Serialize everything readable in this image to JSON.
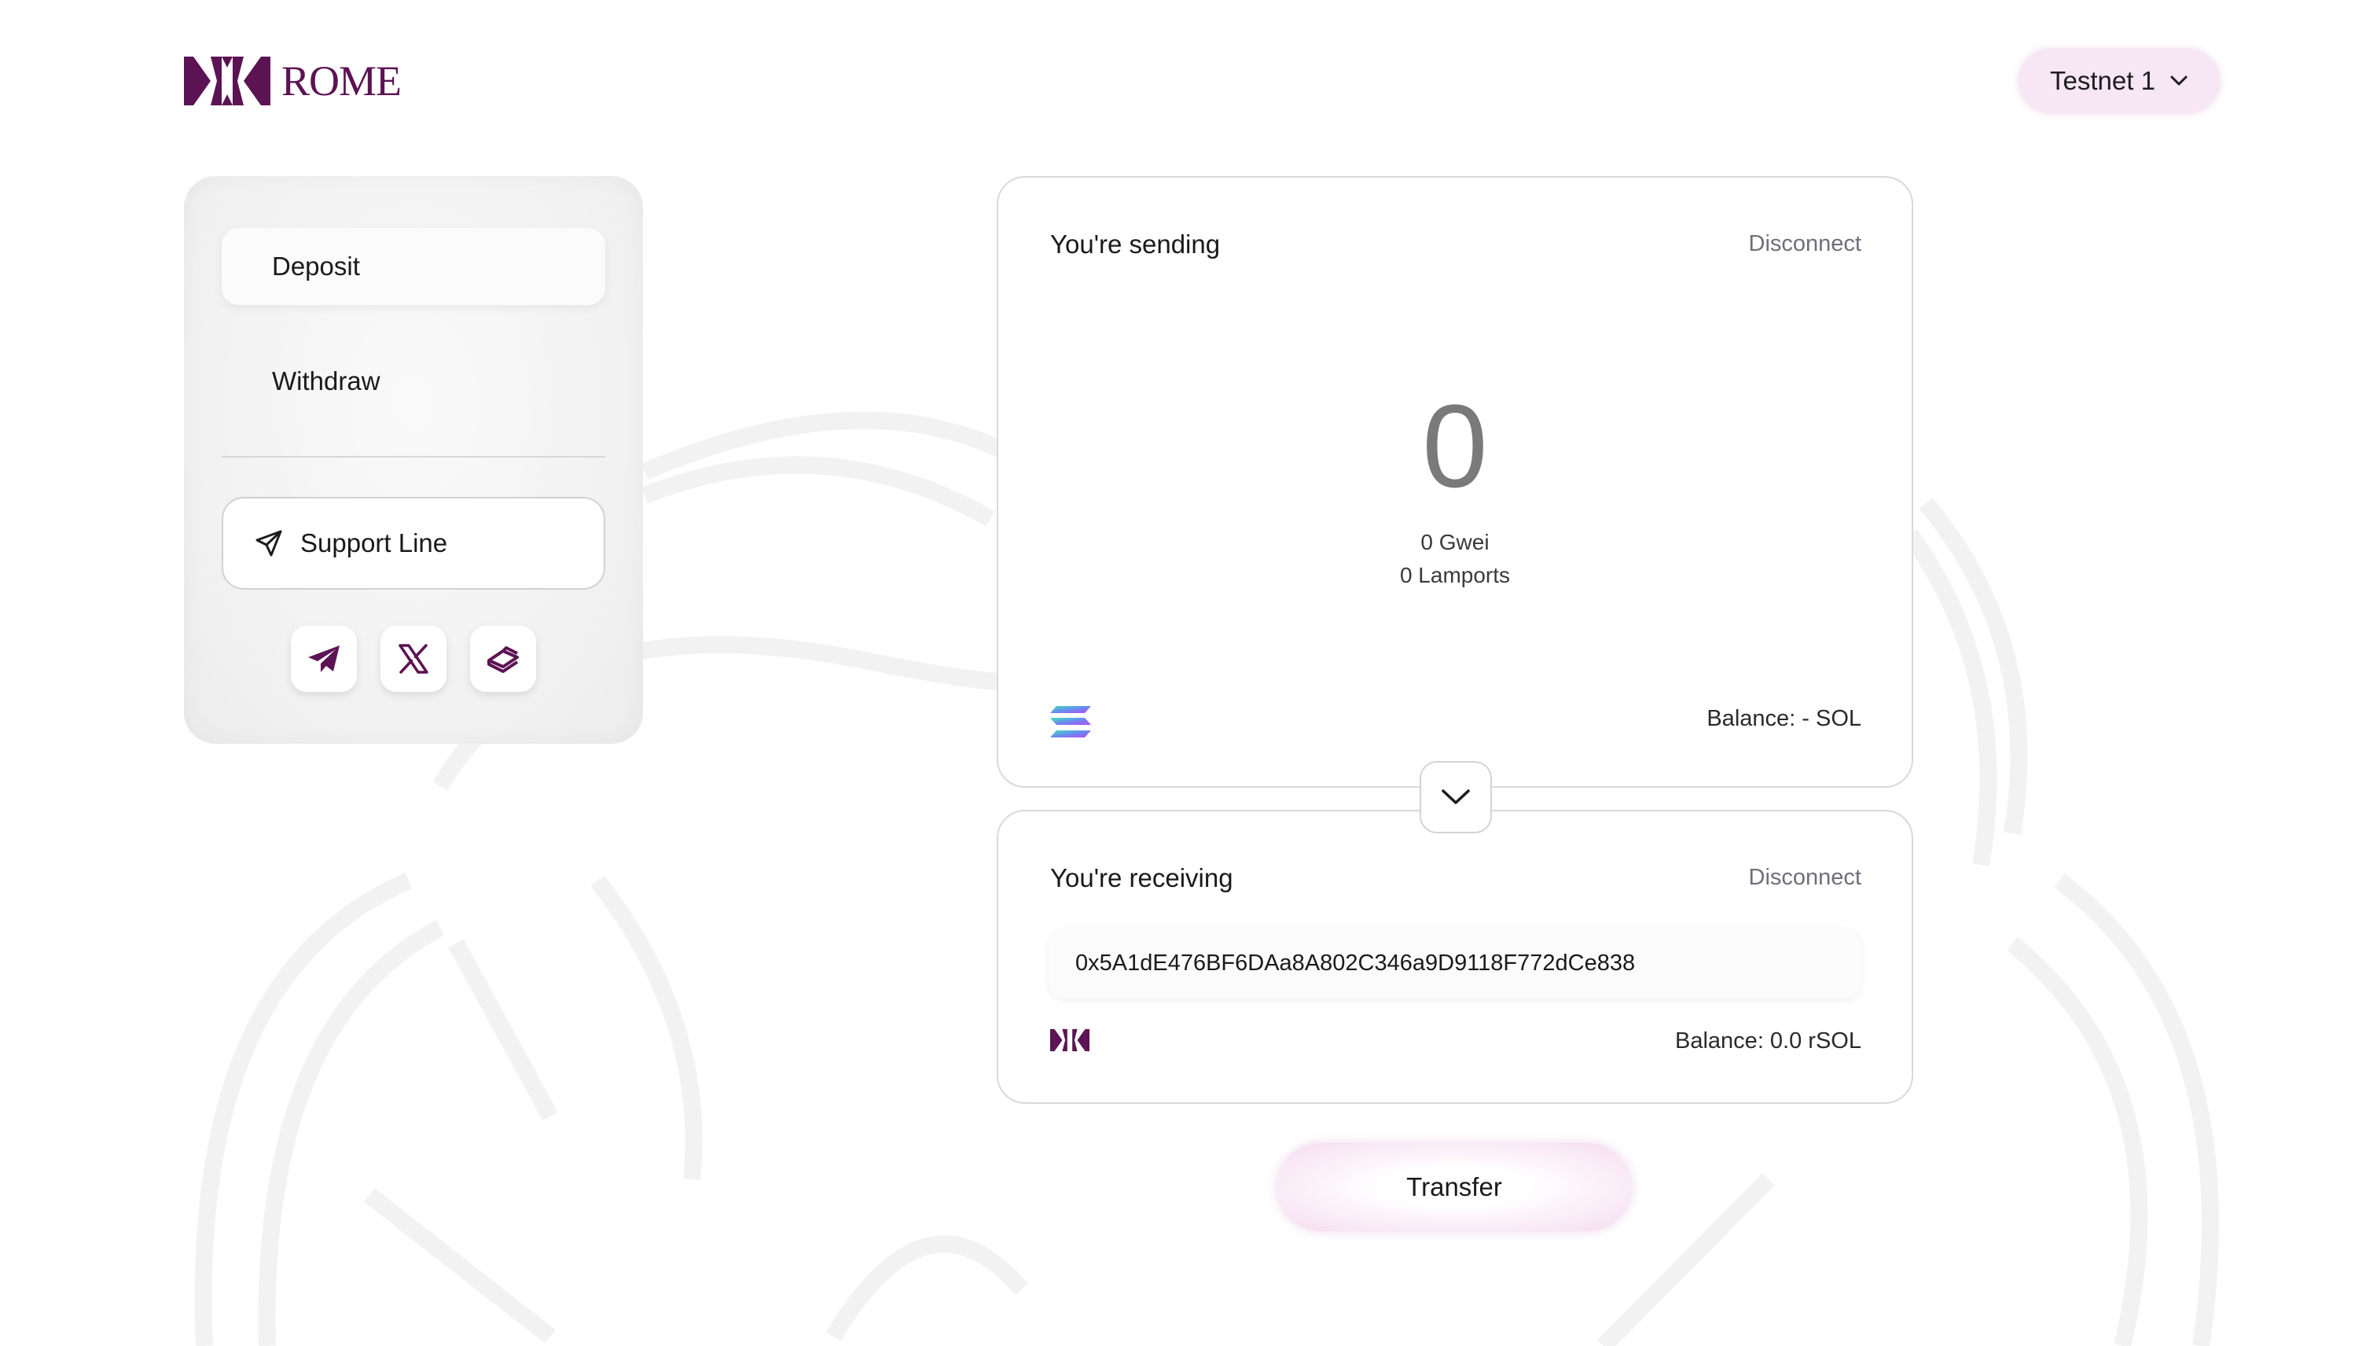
{
  "brand": {
    "name": "ROME",
    "color": "#5c1353"
  },
  "network": {
    "label": "Testnet 1",
    "icon": "chevron-down-icon"
  },
  "sidebar": {
    "items": [
      {
        "label": "Deposit",
        "active": true
      },
      {
        "label": "Withdraw",
        "active": false
      }
    ],
    "support": {
      "label": "Support Line",
      "icon": "paper-plane-icon"
    },
    "socials": [
      {
        "icon": "telegram-icon"
      },
      {
        "icon": "x-icon"
      },
      {
        "icon": "gitbook-icon"
      }
    ]
  },
  "sending": {
    "title": "You're sending",
    "disconnect_label": "Disconnect",
    "amount": "0",
    "gwei": "0 Gwei",
    "lamports": "0 Lamports",
    "token_icon": "solana-icon",
    "balance": "Balance: - SOL"
  },
  "swap": {
    "icon": "chevron-down-icon"
  },
  "receiving": {
    "title": "You're receiving",
    "disconnect_label": "Disconnect",
    "address": "0x5A1dE476BF6DAa8A802C346a9D9118F772dCe838",
    "token_icon": "rome-icon",
    "balance": "Balance: 0.0 rSOL"
  },
  "actions": {
    "transfer_label": "Transfer"
  }
}
